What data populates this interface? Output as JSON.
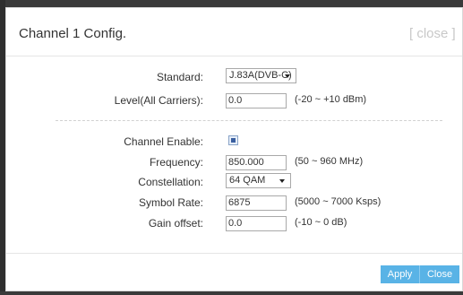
{
  "dialog": {
    "title": "Channel 1 Config.",
    "close_link": "[ close ]"
  },
  "fields": {
    "standard": {
      "label": "Standard:",
      "value": "J.83A(DVB-C)"
    },
    "level": {
      "label": "Level(All Carriers):",
      "value": "0.0",
      "hint": "(-20 ~ +10 dBm)"
    },
    "channel_enable": {
      "label": "Channel Enable:",
      "checked": true
    },
    "frequency": {
      "label": "Frequency:",
      "value": "850.000",
      "hint": "(50 ~ 960 MHz)"
    },
    "constellation": {
      "label": "Constellation:",
      "value": "64 QAM"
    },
    "symbol_rate": {
      "label": "Symbol Rate:",
      "value": "6875",
      "hint": "(5000 ~ 7000 Ksps)"
    },
    "gain_offset": {
      "label": "Gain offset:",
      "value": "0.0",
      "hint": "(-10 ~ 0 dB)"
    }
  },
  "buttons": {
    "apply": "Apply",
    "close": "Close"
  },
  "colors": {
    "button_bg": "#59b3e6",
    "close_link": "#c8c8c8"
  }
}
